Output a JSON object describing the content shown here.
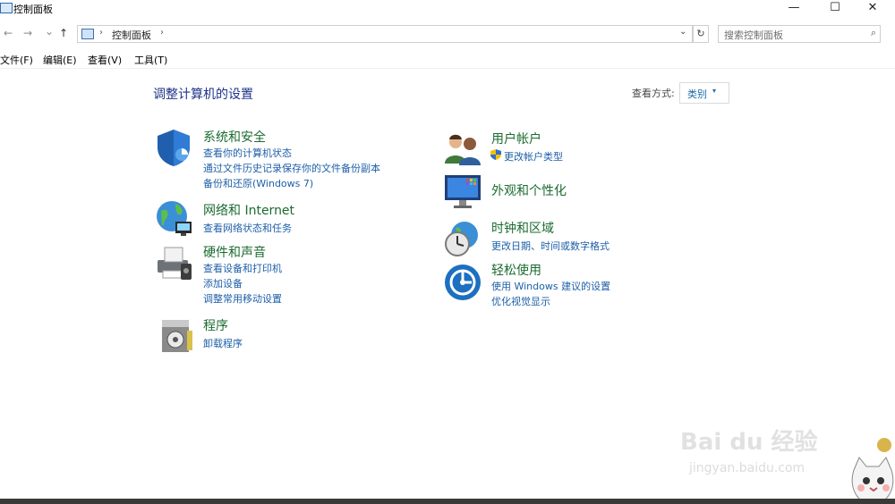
{
  "window": {
    "title": "控制面板",
    "minimize": "—",
    "maximize": "☐",
    "close": "✕"
  },
  "nav": {
    "back": "←",
    "forward": "→",
    "recent": "⌄",
    "up": "↑"
  },
  "address": {
    "sep1": "›",
    "path": "控制面板",
    "sep2": "›",
    "dropdown": "⌄",
    "refresh": "↻"
  },
  "search": {
    "placeholder": "搜索控制面板",
    "icon": "⌕"
  },
  "menu": {
    "file": "文件(F)",
    "edit": "编辑(E)",
    "view": "查看(V)",
    "tools": "工具(T)"
  },
  "page": {
    "title": "调整计算机的设置",
    "view_label": "查看方式:",
    "view_value": "类别",
    "view_caret": "▾"
  },
  "left_categories": [
    {
      "title": "系统和安全",
      "icon": "shield-icon",
      "links": [
        "查看你的计算机状态",
        "通过文件历史记录保存你的文件备份副本",
        "备份和还原(Windows 7)"
      ]
    },
    {
      "title": "网络和 Internet",
      "icon": "globe-icon",
      "links": [
        "查看网络状态和任务"
      ]
    },
    {
      "title": "硬件和声音",
      "icon": "printer-icon",
      "links": [
        "查看设备和打印机",
        "添加设备",
        "调整常用移动设置"
      ]
    },
    {
      "title": "程序",
      "icon": "programs-icon",
      "links": [
        "卸载程序"
      ]
    }
  ],
  "right_categories": [
    {
      "title": "用户帐户",
      "icon": "users-icon",
      "links": [
        "更改帐户类型"
      ]
    },
    {
      "title": "外观和个性化",
      "icon": "monitor-icon",
      "links": []
    },
    {
      "title": "时钟和区域",
      "icon": "clock-icon",
      "links": [
        "更改日期、时间或数字格式"
      ]
    },
    {
      "title": "轻松使用",
      "icon": "accessibility-icon",
      "links": [
        "使用 Windows 建议的设置",
        "优化视觉显示"
      ]
    }
  ],
  "watermark": {
    "main": "Bai du 经验",
    "sub": "jingyan.baidu.com"
  },
  "colors": {
    "category_title": "#1b6b2f",
    "link": "#1e5fa8",
    "heading": "#1e3287"
  }
}
